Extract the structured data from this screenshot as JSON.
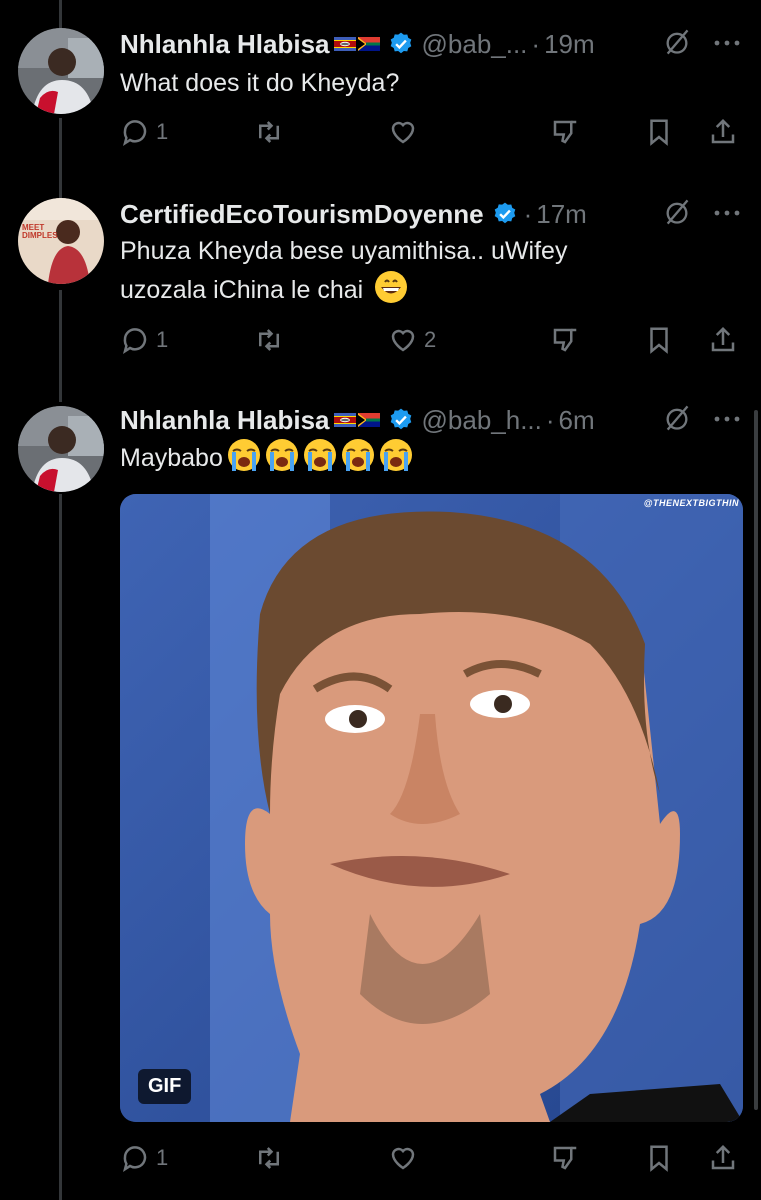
{
  "tweets": [
    {
      "name": "Nhlanhla Hlabisa",
      "handle": "@bab_...",
      "separator": "·",
      "time": "19m",
      "text": "What does it do Kheyda?",
      "reply_count": "1",
      "retweet_count": "",
      "like_count": ""
    },
    {
      "name": "CertifiedEcoTourismDoyenne",
      "handle": "",
      "separator": "·",
      "time": "17m",
      "text_line1": "Phuza Kheyda bese uyamithisa.. uWifey",
      "text_line2": "uzozala iChina le chai",
      "avatar_text": "MEET DIMPLES",
      "reply_count": "1",
      "retweet_count": "",
      "like_count": "2"
    },
    {
      "name": "Nhlanhla Hlabisa",
      "handle": "@bab_h...",
      "separator": "·",
      "time": "6m",
      "text": "Maybabo",
      "media_badge": "GIF",
      "media_watermark": "@THENEXTBIGTHIN",
      "reply_count": "1",
      "retweet_count": "",
      "like_count": ""
    }
  ],
  "colors": {
    "background": "#000000",
    "text": "#e7e9ea",
    "muted": "#71767b",
    "verified": "#1d9bf0",
    "thread_line": "#333639"
  },
  "icons": [
    "reply-icon",
    "retweet-icon",
    "like-icon",
    "dislike-icon",
    "bookmark-icon",
    "share-icon",
    "mute-icon",
    "more-icon",
    "verified-icon"
  ]
}
